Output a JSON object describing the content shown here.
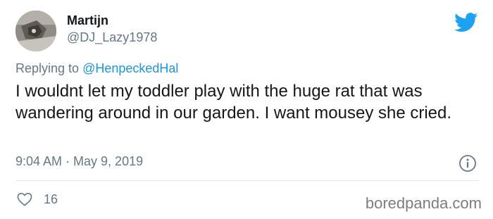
{
  "author": {
    "display_name": "Martijn",
    "handle": "@DJ_Lazy1978",
    "avatar_icon": "profile-photo"
  },
  "reply": {
    "prefix": "Replying to ",
    "mention": "@HenpeckedHal"
  },
  "tweet": {
    "text": "I wouldnt let my toddler play with the huge rat that was wandering around in our garden. I want mousey she cried.",
    "timestamp": "9:04 AM · May 9, 2019"
  },
  "actions": {
    "like_icon": "heart-icon",
    "like_count": "16",
    "info_icon": "info-icon"
  },
  "branding": {
    "platform_icon": "twitter-bird-icon",
    "watermark": "boredpanda.com"
  },
  "colors": {
    "accent": "#1da1f2",
    "link": "#1b95e0",
    "secondary_text": "#657786",
    "primary_text": "#14171a",
    "divider": "#e1e8ed"
  }
}
